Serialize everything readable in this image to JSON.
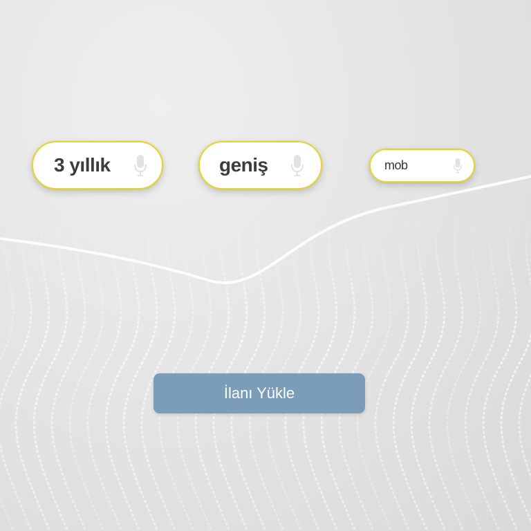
{
  "tags": [
    {
      "text": "3 yıllık",
      "icon": "microphone-icon"
    },
    {
      "text": "geniş",
      "icon": "microphone-icon"
    },
    {
      "text": "mob",
      "icon": "microphone-icon"
    }
  ],
  "upload_button": {
    "label": "İlanı Yükle"
  },
  "colors": {
    "pill_border": "#e6d437",
    "button_bg": "#7c9db8",
    "button_text": "#ffffff"
  }
}
